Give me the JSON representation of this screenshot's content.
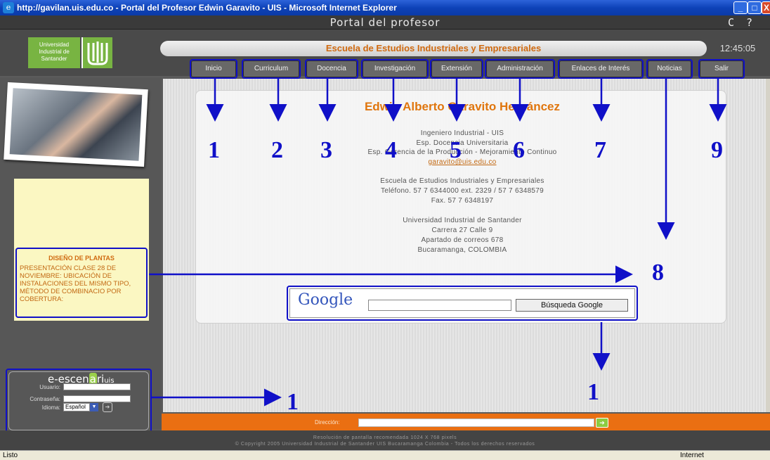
{
  "window": {
    "title": "http://gavilan.uis.edu.co - Portal del Profesor Edwin Garavito - UIS - Microsoft Internet Explorer",
    "min": "_",
    "max": "□",
    "close": "X"
  },
  "portal": {
    "title": "Portal del profesor",
    "icons": "C ? X",
    "school": "Escuela de Estudios Industriales y Empresariales",
    "clock": "12:45:05"
  },
  "logo": {
    "text": "Universidad Industrial de Santander"
  },
  "nav": [
    "Inicio",
    "Curriculum",
    "Docencia",
    "Investigación",
    "Extensión",
    "Administración",
    "Enlaces de Interés",
    "Noticias",
    "Salir"
  ],
  "profile": {
    "name": "Edwin Alberto Garavito Hernáncez",
    "lines": [
      "Ingeniero Industrial - UIS",
      "Esp. Docencia Universitaria",
      "Esp. Gerencia de la Producción - Mejoramiento Continuo"
    ],
    "email": "garavito@uis.edu.co",
    "address": [
      "Escuela de Estudios Industriales y Empresariales",
      "Teléfono. 57 7 6344000 ext. 2329 / 57 7 6348579",
      "Fax. 57 7 6348197",
      "Universidad Industrial de Santander",
      "Carrera 27 Calle 9",
      "Apartado de correos 678",
      "Bucaramanga, COLOMBIA"
    ]
  },
  "notice": {
    "title": "DISEÑO DE PLANTAS",
    "text": "PRESENTACIÓN CLASE 28 DE NOVIEMBRE: UBICACIÓN DE INSTALACIONES DEL MISMO TIPO, MÉTODO DE COMBINACIO POR COBERTURA:"
  },
  "escen": {
    "logo_a": "e-escen",
    "logo_at": "a",
    "logo_b": "ri",
    "logo_c": "uis",
    "user": "Usuario:",
    "pass": "Contraseña:",
    "lang": "Idioma:",
    "lang_value": "Español"
  },
  "google": {
    "logo": "Google",
    "button": "Búsqueda Google"
  },
  "address_bar": {
    "label": "Dirección:"
  },
  "footer": {
    "line1": "Resolución de pantalla recomendada 1024 X 768 pixels",
    "line2": "© Copyright 2005 Universidad Industrial de Santander UIS Bucaramanga Colombia - Todos los derechos reservados"
  },
  "status": {
    "left": "Listo",
    "right": "Internet"
  },
  "annotations": [
    "1",
    "2",
    "3",
    "4",
    "5",
    "6",
    "7",
    "9",
    "8",
    "1",
    "1"
  ]
}
